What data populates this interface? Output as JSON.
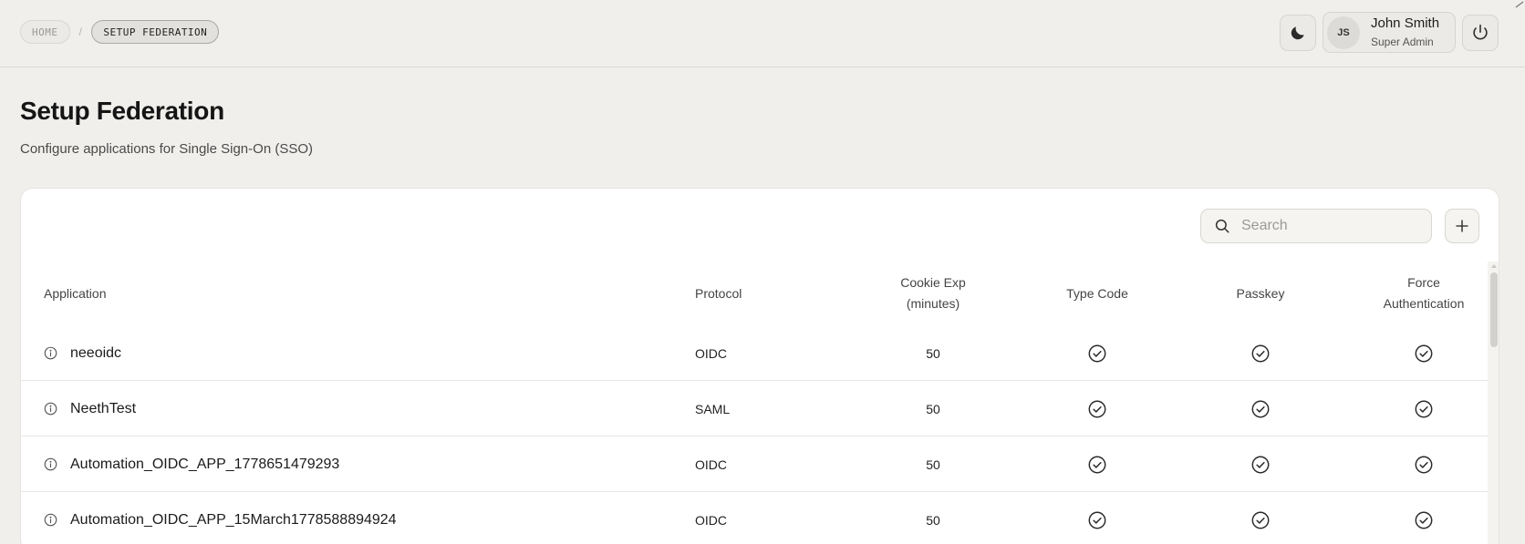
{
  "breadcrumb": {
    "home": "HOME",
    "separator": "/",
    "current": "SETUP FEDERATION"
  },
  "user": {
    "initials": "JS",
    "name": "John Smith",
    "role": "Super Admin"
  },
  "page": {
    "title": "Setup Federation",
    "subtitle": "Configure applications for Single Sign-On (SSO)"
  },
  "search": {
    "placeholder": "Search",
    "value": ""
  },
  "table": {
    "headers": {
      "application": "Application",
      "protocol": "Protocol",
      "cookie_exp_line1": "Cookie Exp",
      "cookie_exp_line2": "(minutes)",
      "type_code": "Type Code",
      "passkey": "Passkey",
      "force_auth_line1": "Force",
      "force_auth_line2": "Authentication"
    },
    "rows": [
      {
        "name": "neeoidc",
        "protocol": "OIDC",
        "cookie_exp": "50",
        "type_code": true,
        "passkey": true,
        "force_auth": true
      },
      {
        "name": "NeethTest",
        "protocol": "SAML",
        "cookie_exp": "50",
        "type_code": true,
        "passkey": true,
        "force_auth": true
      },
      {
        "name": "Automation_OIDC_APP_1778651479293",
        "protocol": "OIDC",
        "cookie_exp": "50",
        "type_code": true,
        "passkey": true,
        "force_auth": true
      },
      {
        "name": "Automation_OIDC_APP_15March1778588894924",
        "protocol": "OIDC",
        "cookie_exp": "50",
        "type_code": true,
        "passkey": true,
        "force_auth": true
      }
    ]
  },
  "colors": {
    "background": "#f0efec",
    "card": "#ffffff",
    "border": "#d8d7d3",
    "text": "#1d1d1d"
  },
  "icons": [
    "moon-icon",
    "power-icon",
    "search-icon",
    "plus-icon",
    "info-icon",
    "check-circle-icon"
  ]
}
